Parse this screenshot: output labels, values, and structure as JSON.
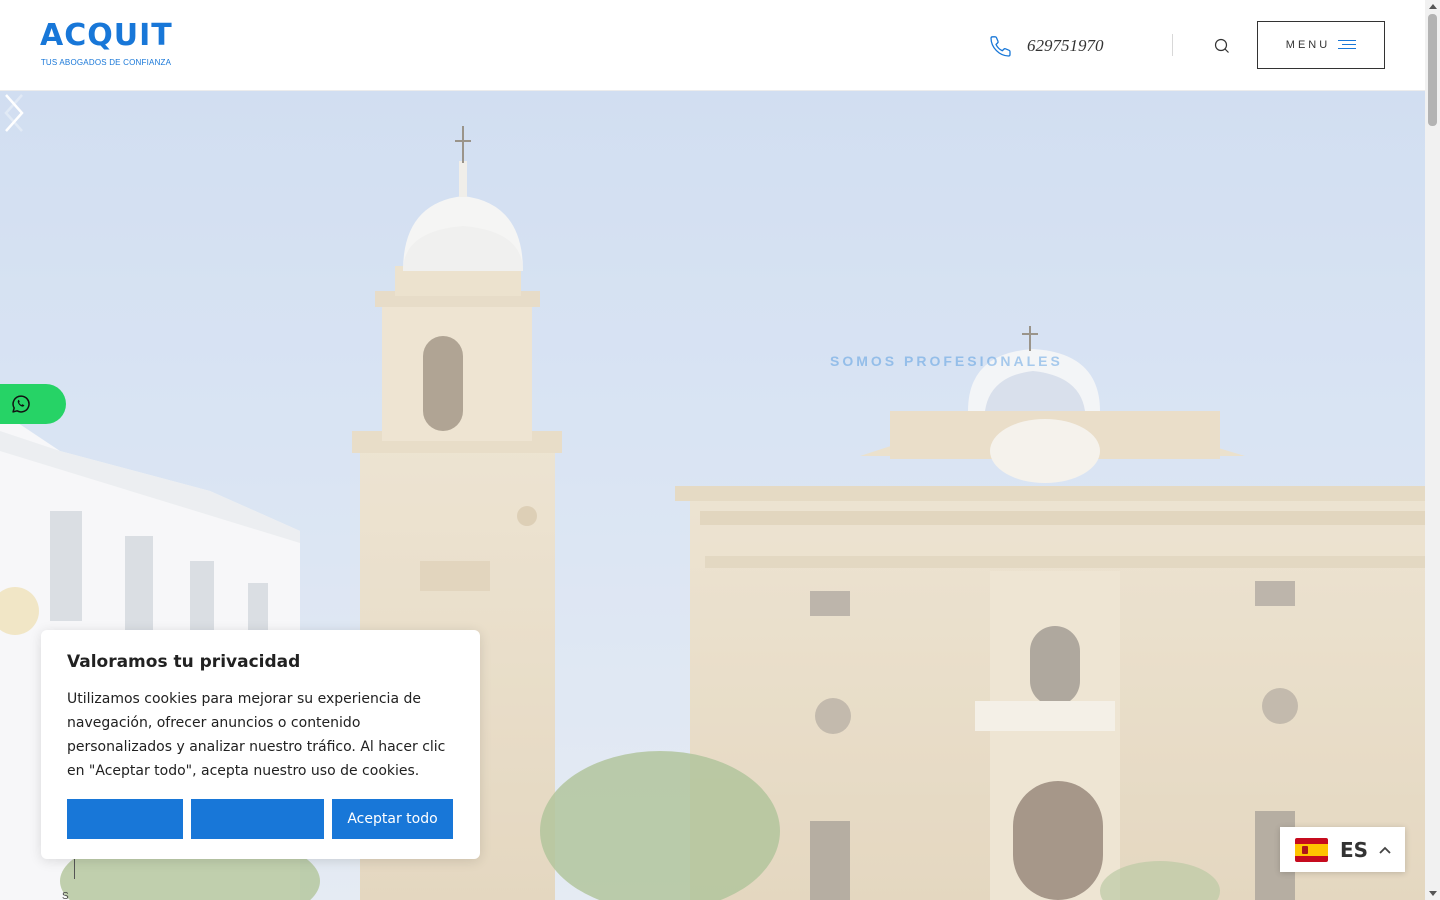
{
  "header": {
    "logo_main": "ACQUIT",
    "logo_tagline": "TUS ABOGADOS DE CONFIANZA",
    "phone": "629751970",
    "menu_label": "MENU",
    "accent_color": "#1877d8"
  },
  "icons": {
    "phone": "phone-icon",
    "search": "search-icon",
    "menu": "hamburger-icon",
    "whatsapp": "whatsapp-icon",
    "next": "chevron-right-icon",
    "prev": "chevron-left-icon",
    "lang_caret": "chevron-up-icon"
  },
  "hero": {
    "caption": "SOMOS PROFESIONALES",
    "scroll_hint": "S"
  },
  "cookie_banner": {
    "title": "Valoramos tu privacidad",
    "text": "Utilizamos cookies para mejorar su experiencia de navegación, ofrecer anuncios o contenido personalizados y analizar nuestro tráfico. Al hacer clic en \"Aceptar todo\", acepta nuestro uso de cookies.",
    "buttons": [
      "",
      "",
      "Aceptar todo"
    ],
    "button_color": "#1877d8"
  },
  "language": {
    "code": "ES",
    "flag": "spain-flag"
  },
  "whatsapp": {
    "color": "#26d366"
  }
}
